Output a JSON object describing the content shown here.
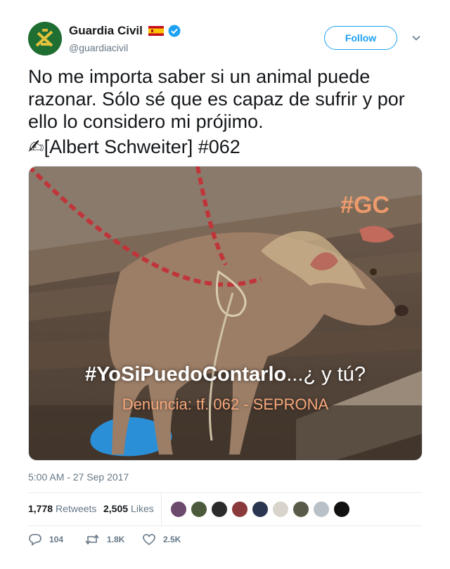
{
  "user": {
    "display_name": "Guardia Civil",
    "handle": "@guardiacivil",
    "flag": "spain-flag",
    "verified_badge": "verified-icon"
  },
  "follow_label": "Follow",
  "tweet": {
    "line1": "No me importa saber si un animal puede razonar. Sólo sé que es capaz de sufrir y por ello lo considero mi prójimo.",
    "emoji": "✍",
    "line2": "[Albert Schweiter] #062"
  },
  "media": {
    "overlay_tag": "#GC",
    "hashtag_bold": "#YoSiPuedoContarlo",
    "hashtag_tail": "...¿ y tú?",
    "denuncia": "Denuncia: tf. 062 - SEPRONA"
  },
  "timestamp": "5:00 AM - 27 Sep 2017",
  "stats": {
    "retweets_count": "1,778",
    "retweets_label": "Retweets",
    "likes_count": "2,505",
    "likes_label": "Likes"
  },
  "likers": [
    "#6b4a6e",
    "#4a5a3a",
    "#2b2b2b",
    "#8a3a3a",
    "#2a3550",
    "#d8d4cc",
    "#5a5a48",
    "#b8c0c8",
    "#111111"
  ],
  "actions": {
    "replies": "104",
    "retweets": "1.8K",
    "likes": "2.5K"
  },
  "colors": {
    "accent": "#1da1f2",
    "muted": "#657786",
    "text": "#14171a"
  }
}
